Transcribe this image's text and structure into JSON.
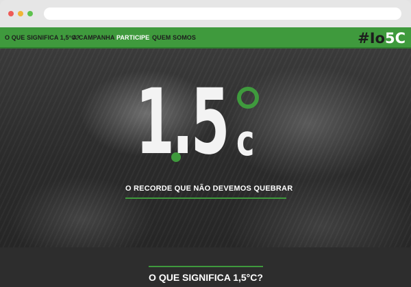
{
  "nav": {
    "items": [
      {
        "label": "O QUE SIGNIFICA 1,5°C?"
      },
      {
        "label": "A CAMPANHA"
      },
      {
        "label": "PARTICIPE"
      },
      {
        "label": "QUEM SOMOS"
      }
    ],
    "active_index": 2,
    "logo": {
      "hash": "#",
      "io": "Io",
      "fivec": "5C"
    }
  },
  "hero": {
    "number": "1.5",
    "unit": "c",
    "tagline": "O RECORDE QUE NÃO DEVEMOS QUEBRAR"
  },
  "section": {
    "title": "O QUE SIGNIFICA 1,5°C?"
  },
  "colors": {
    "accent": "#3f9a3d",
    "dark": "#2d2d2d",
    "text_light": "#ffffff"
  }
}
